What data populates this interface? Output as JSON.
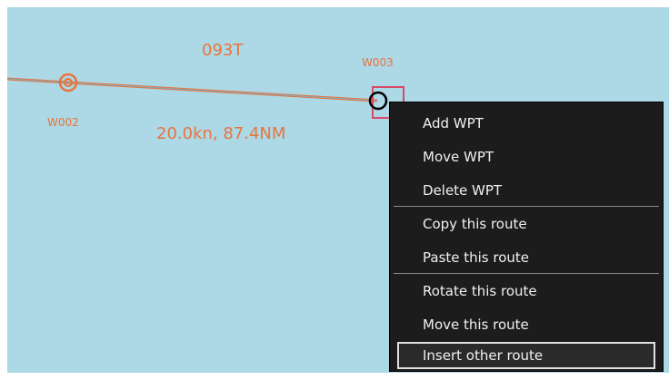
{
  "route": {
    "course": "093T",
    "speed_distance": "20.0kn, 87.4NM",
    "color": "#e8743b"
  },
  "waypoints": [
    {
      "name": "W002"
    },
    {
      "name": "W003"
    }
  ],
  "context_menu": {
    "items": [
      {
        "label": "Add WPT"
      },
      {
        "label": "Move WPT"
      },
      {
        "label": "Delete WPT"
      },
      {
        "label": "Copy this route"
      },
      {
        "label": "Paste this route"
      },
      {
        "label": "Rotate this route"
      },
      {
        "label": "Move this route"
      },
      {
        "label": "Insert other route"
      }
    ],
    "selected_item": "Insert other route"
  },
  "colors": {
    "sea": "#add8e6",
    "route": "#e8743b",
    "menu_background": "#1c1c1c",
    "cursor_box": "#d84a6a"
  }
}
